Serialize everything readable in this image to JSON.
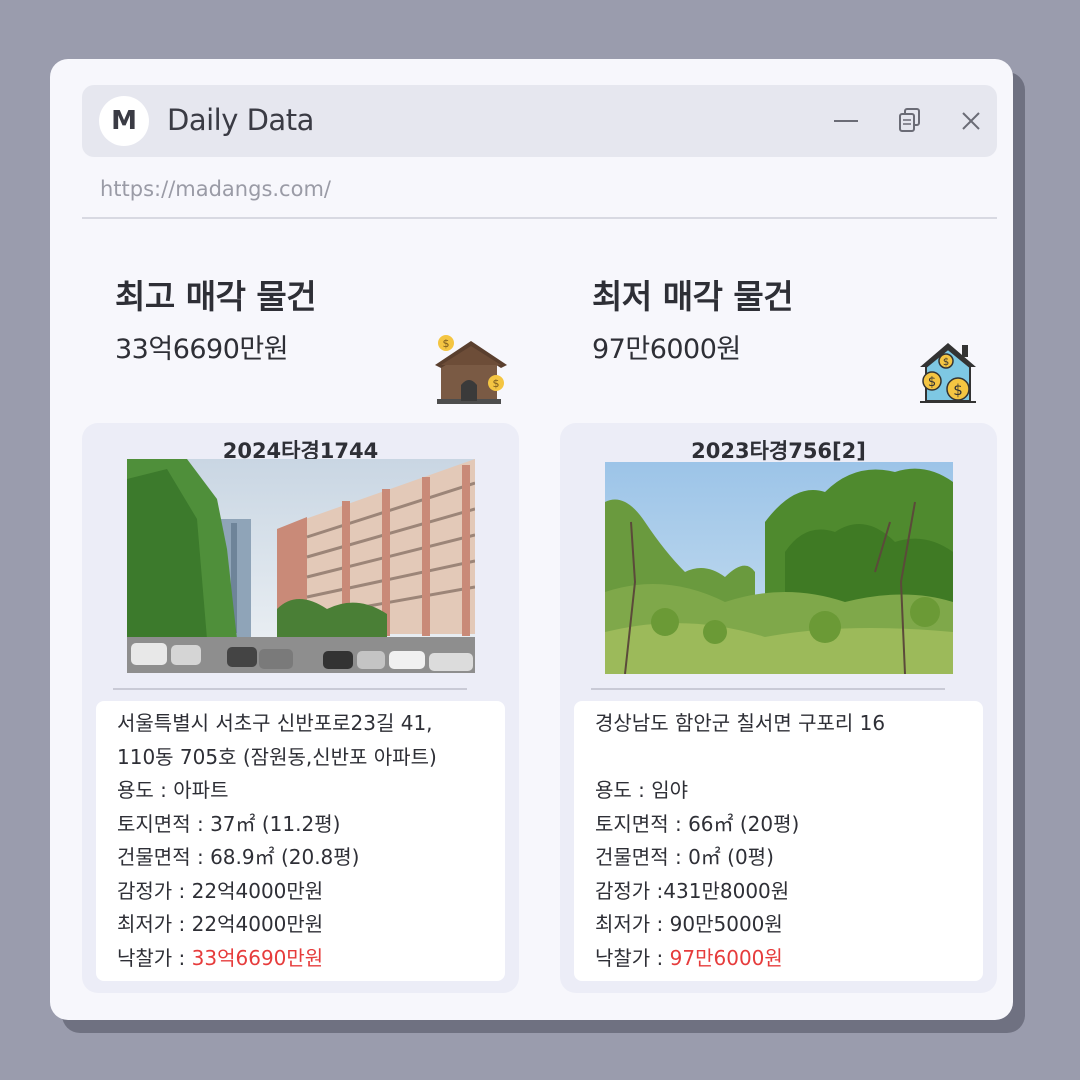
{
  "window": {
    "logo_letter": "M",
    "title": "Daily Data",
    "url": "https://madangs.com/"
  },
  "colors": {
    "background": "#9a9cad",
    "window": "#f7f7fc",
    "titlebar": "#e6e7ef",
    "card": "#ecedf7",
    "highlight": "#e63c3c"
  },
  "highest": {
    "heading": "최고 매각 물건",
    "price": "33억6690만원",
    "icon": "house-money-icon",
    "case_no": "2024타경1744",
    "photo": "apartment-photo",
    "address_line1": "서울특별시 서초구 신반포로23길 41,",
    "address_line2": "110동 705호 (잠원동,신반포 아파트)",
    "usage_label": "용도 : ",
    "usage": "아파트",
    "land_label": "토지면적 : ",
    "land": "37㎡ (11.2평)",
    "building_label": "건물면적 : ",
    "building": "68.9㎡ (20.8평)",
    "appraisal_label": "감정가 : ",
    "appraisal": "22억4000만원",
    "minimum_label": "최저가 : ",
    "minimum": "22억4000만원",
    "winning_label": "낙찰가 : ",
    "winning": "33억6690만원"
  },
  "lowest": {
    "heading": "최저 매각 물건",
    "price": "97만6000원",
    "icon": "house-coins-icon",
    "case_no": "2023타경756[2]",
    "photo": "forest-land-photo",
    "address_line1": "경상남도 함안군 칠서면 구포리 16",
    "usage_label": "용도 : ",
    "usage": "임야",
    "land_label": "토지면적 : ",
    "land": "66㎡ (20평)",
    "building_label": "건물면적 : ",
    "building": "0㎡ (0평)",
    "appraisal_label": "감정가 :",
    "appraisal": "431만8000원",
    "minimum_label": "최저가 : ",
    "minimum": "90만5000원",
    "winning_label": "낙찰가 : ",
    "winning": "97만6000원"
  }
}
